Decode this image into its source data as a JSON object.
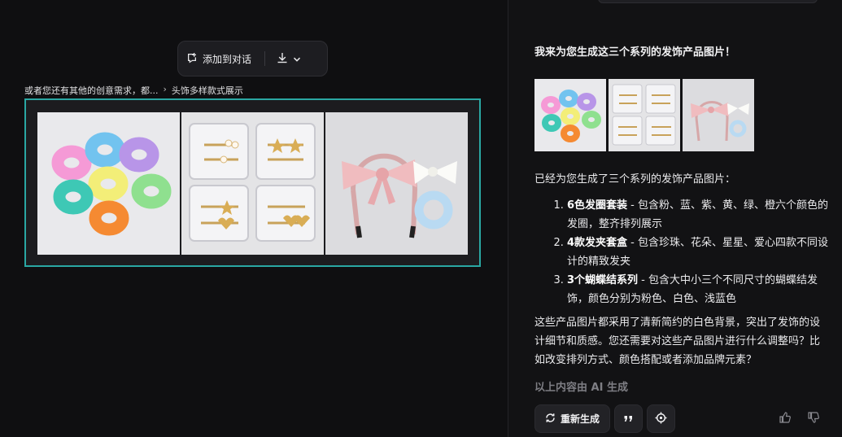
{
  "toolbar": {
    "add_to_chat_label": "添加到对话",
    "icons": [
      "chat-add-icon",
      "download-icon",
      "chevron-down-icon"
    ]
  },
  "breadcrumb": {
    "prefix": "或者您还有其他的创意需求，都...",
    "current": "头饰多样款式展示"
  },
  "panel": {
    "intro": "我来为您生成这三个系列的发饰产品图片！",
    "generated_heading": "已经为您生成了三个系列的发饰产品图片：",
    "list": [
      {
        "title": "6色发圈套装",
        "desc": " - 包含粉、蓝、紫、黄、绿、橙六个颜色的发圈，整齐排列展示"
      },
      {
        "title": "4款发夹套盒",
        "desc": " - 包含珍珠、花朵、星星、爱心四款不同设计的精致发夹"
      },
      {
        "title": "3个蝴蝶结系列",
        "desc": " - 包含大中小三个不同尺寸的蝴蝶结发饰，颜色分别为粉色、白色、浅蓝色"
      }
    ],
    "summary": "这些产品图片都采用了清新简约的白色背景，突出了发饰的设计细节和质感。您还需要对这些产品图片进行什么调整吗？比如改变排列方式、颜色搭配或者添加品牌元素？",
    "ai_note": "以上内容由 AI 生成",
    "regenerate_label": "重新生成"
  },
  "colors": {
    "accent_border": "#2aa7a3",
    "scrunchie_colors": [
      "#f59ad6",
      "#72c3ef",
      "#b895e8",
      "#f3ee78",
      "#8fe08f",
      "#3ec8b5",
      "#f58a32"
    ]
  }
}
